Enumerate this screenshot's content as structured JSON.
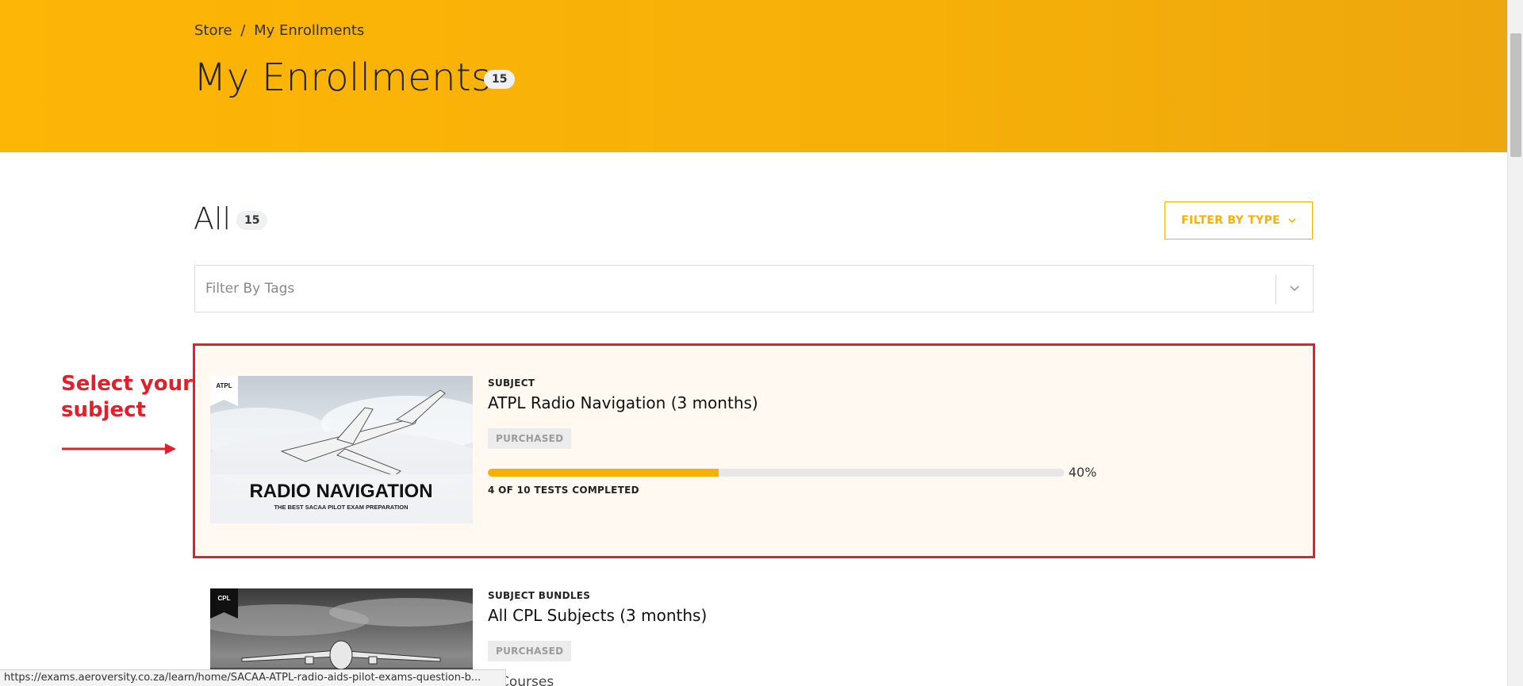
{
  "breadcrumb": {
    "store": "Store",
    "separator": "/",
    "current": "My Enrollments"
  },
  "header": {
    "title": "My Enrollments",
    "count": "15"
  },
  "section": {
    "title": "All",
    "count": "15"
  },
  "filter_type": {
    "label": "FILTER BY TYPE",
    "icon": "chevron-down-icon"
  },
  "tags_filter": {
    "placeholder": "Filter By Tags",
    "icon": "chevron-down-icon"
  },
  "annotation": {
    "text": "Select your subject",
    "color": "#e0202c"
  },
  "cards": [
    {
      "kind": "SUBJECT",
      "title": "ATPL Radio Navigation (3 months)",
      "status": "PURCHASED",
      "thumbnail": {
        "flag": "ATPL",
        "headline": "RADIO NAVIGATION",
        "subline": "THE BEST SACAA PILOT EXAM PREPARATION"
      },
      "progress": {
        "percent": 40,
        "percent_label": "40%",
        "label": "4 OF 10 TESTS COMPLETED"
      }
    },
    {
      "kind": "SUBJECT BUNDLES",
      "title": "All CPL Subjects (3 months)",
      "status": "PURCHASED",
      "thumbnail": {
        "flag": "CPL"
      },
      "extra": "Courses"
    }
  ],
  "status_url": "https://exams.aeroversity.co.za/learn/home/SACAA-ATPL-radio-aids-pilot-exams-question-b...",
  "colors": {
    "brand": "#fdb506",
    "accent": "#f5b106",
    "highlight": "#e0202c"
  }
}
